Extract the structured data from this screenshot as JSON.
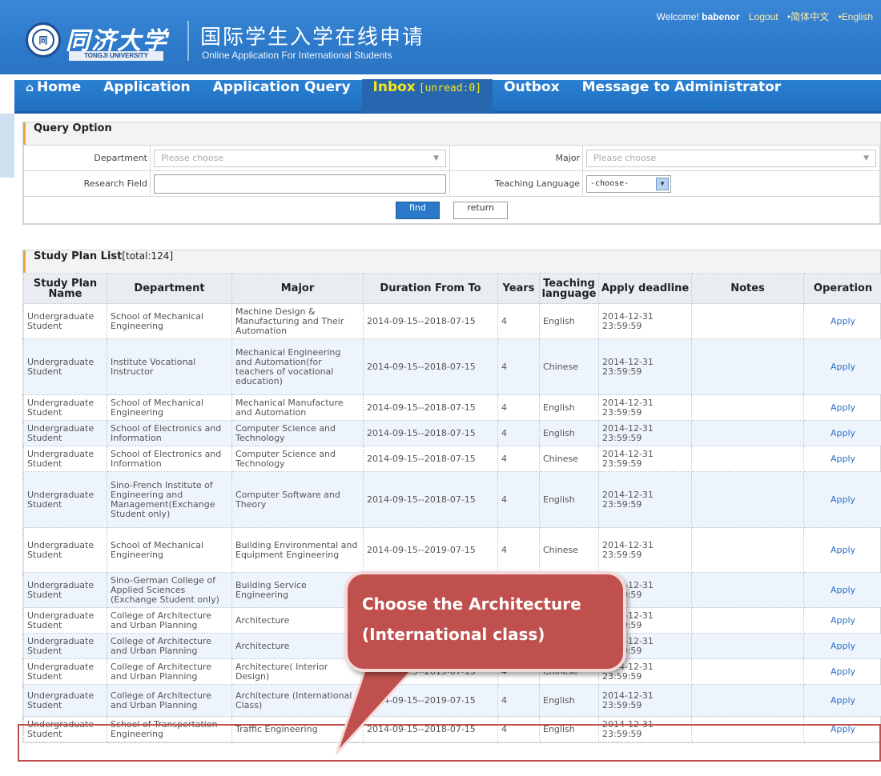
{
  "header": {
    "logo_cn": "同济大学",
    "logo_en": "TONGJI UNIVERSITY",
    "title_cn": "国际学生入学在线申请",
    "title_en": "Online Application For International Students",
    "welcome": "Welcome!",
    "username": "babenor",
    "logout": "Logout",
    "lang_cn": "•简体中文",
    "lang_en": "•English"
  },
  "nav": {
    "home": "Home",
    "application": "Application",
    "query": "Application Query",
    "inbox": "Inbox",
    "inbox_unread": "[unread:0]",
    "outbox": "Outbox",
    "message": "Message to Administrator"
  },
  "query": {
    "title": "Query Option",
    "department_label": "Department",
    "department_placeholder": "Please choose",
    "major_label": "Major",
    "major_placeholder": "Please choose",
    "research_label": "Research Field",
    "research_value": "",
    "teaching_label": "Teaching Language",
    "teaching_value": "-choose-",
    "find": "find",
    "return": "return"
  },
  "plan": {
    "title": "Study Plan List",
    "total": "[total:124]",
    "columns": [
      "Study Plan Name",
      "Department",
      "Major",
      "Duration From To",
      "Years",
      "Teaching language",
      "Apply deadline",
      "Notes",
      "Operation"
    ],
    "rows": [
      [
        "Undergraduate Student",
        "School of Mechanical Engineering",
        "Machine Design & Manufacturing and Their Automation",
        "2014-09-15--2018-07-15",
        "4",
        "English",
        "2014-12-31 23:59:59",
        "",
        "Apply"
      ],
      [
        "Undergraduate Student",
        "Institute Vocational Instructor",
        "Mechanical Engineering and Automation(for teachers of vocational education)",
        "2014-09-15--2018-07-15",
        "4",
        "Chinese",
        "2014-12-31 23:59:59",
        "",
        "Apply"
      ],
      [
        "Undergraduate Student",
        "School of Mechanical Engineering",
        "Mechanical Manufacture and Automation",
        "2014-09-15--2018-07-15",
        "4",
        "English",
        "2014-12-31 23:59:59",
        "",
        "Apply"
      ],
      [
        "Undergraduate Student",
        "School of Electronics and Information",
        "Computer Science and Technology",
        "2014-09-15--2018-07-15",
        "4",
        "English",
        "2014-12-31 23:59:59",
        "",
        "Apply"
      ],
      [
        "Undergraduate Student",
        "School of Electronics and Information",
        "Computer Science and Technology",
        "2014-09-15--2018-07-15",
        "4",
        "Chinese",
        "2014-12-31 23:59:59",
        "",
        "Apply"
      ],
      [
        "Undergraduate Student",
        "Sino-French Institute of Engineering and Management(Exchange Student only)",
        "Computer Software and Theory",
        "2014-09-15--2018-07-15",
        "4",
        "English",
        "2014-12-31 23:59:59",
        "",
        "Apply"
      ],
      [
        "Undergraduate Student",
        "School of Mechanical Engineering",
        "Building Environmental and Equipment Engineering",
        "2014-09-15--2019-07-15",
        "4",
        "Chinese",
        "2014-12-31 23:59:59",
        "",
        "Apply"
      ],
      [
        "Undergraduate Student",
        "Sino-German College of Applied Sciences (Exchange Student only)",
        "Building Service Engineering",
        "",
        "",
        "",
        "2014-12-31 23:59:59",
        "",
        "Apply"
      ],
      [
        "Undergraduate Student",
        "College of Architecture and Urban Planning",
        "Architecture",
        "",
        "",
        "",
        "2014-12-31 23:59:59",
        "",
        "Apply"
      ],
      [
        "Undergraduate Student",
        "College of Architecture and Urban Planning",
        "Architecture",
        "",
        "",
        "",
        "2014-12-31 23:59:59",
        "",
        "Apply"
      ],
      [
        "Undergraduate Student",
        "College of Architecture and Urban Planning",
        "Architecture( Interior Design)",
        "2014-09-15--2019-07-15",
        "4",
        "Chinese",
        "2014-12-31 23:59:59",
        "",
        "Apply"
      ],
      [
        "Undergraduate Student",
        "College of Architecture and Urban Planning",
        "Architecture (International Class)",
        "2014-09-15--2019-07-15",
        "4",
        "English",
        "2014-12-31 23:59:59",
        "",
        "Apply"
      ],
      [
        "Undergraduate Student",
        "School of Transportation Engineering",
        "Traffic Engineering",
        "2014-09-15--2018-07-15",
        "4",
        "English",
        "2014-12-31 23:59:59",
        "",
        "Apply"
      ]
    ]
  },
  "callout": {
    "line1": "Choose  the  Architecture",
    "line2": "(International class)"
  },
  "colors": {
    "nav_bg": "#1f6fc0",
    "inbox_text": "#f6e61c",
    "callout": "#c0504d",
    "link": "#2a6fc4"
  }
}
